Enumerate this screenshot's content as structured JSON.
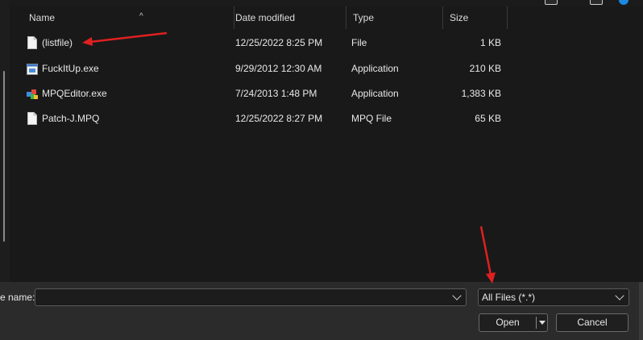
{
  "columns": {
    "name": "Name",
    "date": "Date modified",
    "type": "Type",
    "size": "Size"
  },
  "files": [
    {
      "name": "(listfile)",
      "date": "12/25/2022 8:25 PM",
      "type": "File",
      "size": "1 KB",
      "icon": "document-icon"
    },
    {
      "name": "FuckItUp.exe",
      "date": "9/29/2012 12:30 AM",
      "type": "Application",
      "size": "210 KB",
      "icon": "application-icon"
    },
    {
      "name": "MPQEditor.exe",
      "date": "7/24/2013 1:48 PM",
      "type": "Application",
      "size": "1,383 KB",
      "icon": "mpq-editor-icon"
    },
    {
      "name": "Patch-J.MPQ",
      "date": "12/25/2022 8:27 PM",
      "type": "MPQ File",
      "size": "65 KB",
      "icon": "document-icon"
    }
  ],
  "bottom": {
    "filename_label": "e name:",
    "filename_value": "",
    "filter_value": "All Files (*.*)",
    "open_label": "Open",
    "cancel_label": "Cancel"
  },
  "colors": {
    "background": "#191919",
    "bottom_bar": "#2b2b2b",
    "annotation_arrow": "#e02020"
  }
}
